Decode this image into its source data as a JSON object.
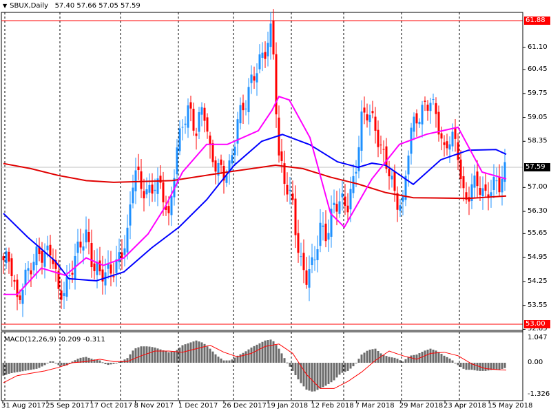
{
  "header": {
    "symbol": "SBUX,Daily",
    "open": "57.40",
    "high": "57.66",
    "low": "57.05",
    "close": "57.59",
    "icon": "triangle-down-icon"
  },
  "colors": {
    "bull": "#1e90ff",
    "bear": "#ff0000",
    "ma_fast": "#ff00ff",
    "ma_mid": "#0000ff",
    "ma_slow": "#e00000",
    "level": "#ff0000",
    "macd_hist": "#6b6b6b",
    "macd_signal": "#ff0000",
    "current": "#000000"
  },
  "price_axis": {
    "labels": [
      "61.10",
      "60.45",
      "59.75",
      "59.05",
      "58.35",
      "57.00",
      "56.30",
      "55.65",
      "54.95",
      "54.25",
      "53.55",
      "52.85"
    ],
    "upper_level": "61.88",
    "lower_level": "53.00",
    "current": "57.59"
  },
  "macd": {
    "title": "MACD(12,26,9)",
    "main": "-0.209",
    "signal": "-0.311",
    "axis_labels": [
      "1.047",
      "0.00",
      "-1.326"
    ]
  },
  "date_axis": [
    "31 Aug 2017",
    "25 Sep 2017",
    "17 Oct 2017",
    "8 Nov 2017",
    "1 Dec 2017",
    "26 Dec 2017",
    "19 Jan 2018",
    "12 Feb 2018",
    "7 Mar 2018",
    "29 Mar 2018",
    "23 Apr 2018",
    "15 May 2018"
  ],
  "chart_data": {
    "type": "candlestick",
    "title": "SBUX,Daily",
    "ylim": [
      52.85,
      61.88
    ],
    "closes_sampled": [
      54.87,
      54.9,
      53.6,
      54.3,
      54.7,
      55.1,
      55.0,
      55.2,
      53.9,
      54.0,
      54.7,
      55.3,
      55.6,
      54.7,
      54.5,
      54.5,
      54.6,
      55.0,
      55.6,
      57.65,
      57.0,
      56.8,
      57.1,
      57.0,
      56.0,
      57.9,
      58.9,
      59.3,
      58.6,
      59.5,
      58.0,
      57.6,
      57.4,
      57.6,
      59.0,
      59.4,
      60.1,
      60.6,
      61.0,
      61.68,
      57.85,
      57.1,
      56.5,
      54.83,
      54.4,
      54.8,
      55.8,
      55.6,
      56.5,
      56.6,
      56.5,
      57.3,
      59.0,
      59.26,
      58.7,
      58.0,
      57.5,
      56.6,
      56.5,
      58.6,
      59.0,
      59.3,
      59.57,
      59.0,
      58.0,
      58.6,
      58.0,
      56.44,
      57.1,
      57.1,
      56.7,
      57.1,
      57.1,
      57.59
    ],
    "ma_slow": [
      [
        0,
        57.7
      ],
      [
        4,
        57.55
      ],
      [
        8,
        57.35
      ],
      [
        12,
        57.2
      ],
      [
        16,
        57.15
      ],
      [
        24.5,
        57.2
      ],
      [
        32.5,
        57.45
      ],
      [
        39.5,
        57.65
      ],
      [
        43.5,
        57.55
      ],
      [
        47.5,
        57.3
      ],
      [
        51.5,
        57.1
      ],
      [
        55.5,
        56.85
      ],
      [
        59.5,
        56.7
      ],
      [
        67.5,
        56.68
      ],
      [
        73,
        56.75
      ]
    ],
    "ma_mid": [
      [
        0,
        56.24
      ],
      [
        3.5,
        55.55
      ],
      [
        7.5,
        54.85
      ],
      [
        9.5,
        54.33
      ],
      [
        13.5,
        54.27
      ],
      [
        17.5,
        54.53
      ],
      [
        21.5,
        55.23
      ],
      [
        25.5,
        55.84
      ],
      [
        29.5,
        56.64
      ],
      [
        33.5,
        57.65
      ],
      [
        37.5,
        58.35
      ],
      [
        40.5,
        58.55
      ],
      [
        44.5,
        58.25
      ],
      [
        48.5,
        57.75
      ],
      [
        51.5,
        57.59
      ],
      [
        53.5,
        57.71
      ],
      [
        55.5,
        57.65
      ],
      [
        59.5,
        57.09
      ],
      [
        63.5,
        57.81
      ],
      [
        67.5,
        58.09
      ],
      [
        71.5,
        58.11
      ],
      [
        73,
        57.97
      ]
    ],
    "ma_fast": [
      [
        0,
        53.87
      ],
      [
        2,
        53.87
      ],
      [
        5.5,
        54.64
      ],
      [
        9,
        54.43
      ],
      [
        12,
        54.94
      ],
      [
        14.5,
        54.72
      ],
      [
        17.5,
        54.94
      ],
      [
        21,
        55.64
      ],
      [
        23.5,
        56.44
      ],
      [
        26,
        57.45
      ],
      [
        29.5,
        58.26
      ],
      [
        32.5,
        58.26
      ],
      [
        37,
        58.66
      ],
      [
        39,
        59.26
      ],
      [
        40,
        59.66
      ],
      [
        41.5,
        59.56
      ],
      [
        44.5,
        58.46
      ],
      [
        47.5,
        56.24
      ],
      [
        49.5,
        55.84
      ],
      [
        53.5,
        57.25
      ],
      [
        57.5,
        58.26
      ],
      [
        61.5,
        58.56
      ],
      [
        66,
        58.76
      ],
      [
        69.5,
        57.45
      ],
      [
        73,
        57.25
      ]
    ],
    "macd_hist": [
      -0.55,
      -0.45,
      -0.4,
      -0.35,
      -0.3,
      -0.25,
      -0.1,
      0.1,
      -0.1,
      -0.15,
      0.05,
      0.2,
      0.25,
      0.15,
      0.1,
      -0.1,
      -0.05,
      0.05,
      0.2,
      0.6,
      0.7,
      0.7,
      0.65,
      0.55,
      0.45,
      0.5,
      0.75,
      0.85,
      0.95,
      0.85,
      0.6,
      0.3,
      0.1,
      0.1,
      0.3,
      0.45,
      0.65,
      0.8,
      0.95,
      1.0,
      0.6,
      0.1,
      -0.35,
      -0.8,
      -1.15,
      -1.25,
      -1.1,
      -0.95,
      -0.75,
      -0.45,
      -0.35,
      -0.1,
      0.35,
      0.55,
      0.6,
      0.35,
      0.25,
      0.2,
      0.05,
      0.3,
      0.35,
      0.5,
      0.6,
      0.5,
      0.3,
      0.15,
      -0.1,
      -0.3,
      -0.3,
      -0.35,
      -0.35,
      -0.3,
      -0.3,
      -0.209
    ],
    "macd_signal": [
      [
        0,
        -0.85
      ],
      [
        2,
        -0.55
      ],
      [
        4,
        -0.45
      ],
      [
        6,
        -0.35
      ],
      [
        8,
        -0.2
      ],
      [
        10,
        0.0
      ],
      [
        12,
        0.05
      ],
      [
        14,
        0.15
      ],
      [
        16,
        0.05
      ],
      [
        18,
        0.05
      ],
      [
        20,
        0.3
      ],
      [
        22,
        0.5
      ],
      [
        24,
        0.5
      ],
      [
        26,
        0.45
      ],
      [
        28,
        0.6
      ],
      [
        30,
        0.75
      ],
      [
        32,
        0.45
      ],
      [
        34,
        0.25
      ],
      [
        36,
        0.4
      ],
      [
        38,
        0.7
      ],
      [
        40,
        0.8
      ],
      [
        42,
        0.4
      ],
      [
        44,
        -0.5
      ],
      [
        46,
        -1.1
      ],
      [
        48,
        -1.1
      ],
      [
        50,
        -0.8
      ],
      [
        52,
        -0.4
      ],
      [
        54,
        0.1
      ],
      [
        56,
        0.5
      ],
      [
        58,
        0.3
      ],
      [
        60,
        0.15
      ],
      [
        62,
        0.4
      ],
      [
        64,
        0.45
      ],
      [
        66,
        0.3
      ],
      [
        68,
        -0.05
      ],
      [
        70,
        -0.25
      ],
      [
        72,
        -0.3
      ],
      [
        73,
        -0.311
      ]
    ],
    "macd_ylim": [
      -1.326,
      1.047
    ]
  }
}
